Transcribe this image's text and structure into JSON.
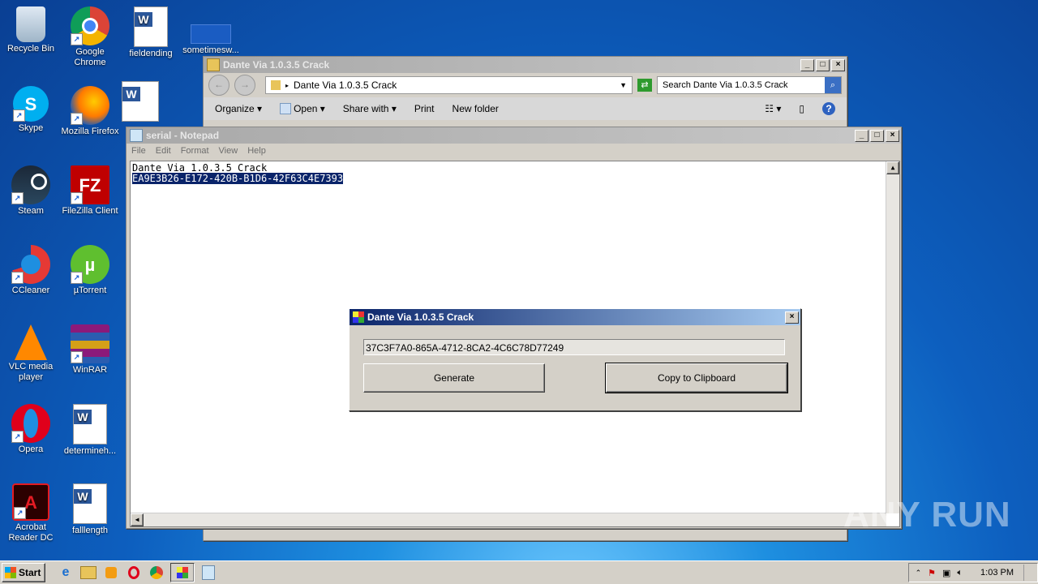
{
  "desktop": {
    "icons": [
      {
        "label": "Recycle Bin"
      },
      {
        "label": "Google Chrome"
      },
      {
        "label": "fieldending"
      },
      {
        "label": "sometimesw..."
      },
      {
        "label": "Skype"
      },
      {
        "label": "Mozilla Firefox"
      },
      {
        "label": "Steam"
      },
      {
        "label": "FileZilla Client"
      },
      {
        "label": "CCleaner"
      },
      {
        "label": "µTorrent"
      },
      {
        "label": "VLC media player"
      },
      {
        "label": "WinRAR"
      },
      {
        "label": "Opera"
      },
      {
        "label": "determineh..."
      },
      {
        "label": "Acrobat Reader DC"
      },
      {
        "label": "falllength"
      }
    ]
  },
  "explorer": {
    "title": "Dante Via 1.0.3.5 Crack",
    "address": "Dante Via 1.0.3.5 Crack",
    "search_placeholder": "Search Dante Via 1.0.3.5 Crack",
    "toolbar": {
      "organize": "Organize",
      "open": "Open",
      "share_with": "Share with",
      "print": "Print",
      "new_folder": "New folder"
    }
  },
  "notepad": {
    "title": "serial - Notepad",
    "menu": [
      "File",
      "Edit",
      "Format",
      "View",
      "Help"
    ],
    "line1": "Dante Via 1.0.3.5 Crack",
    "line2_selected": "EA9E3B26-E172-420B-B1D6-42F63C4E7393"
  },
  "keygen": {
    "title": "Dante Via 1.0.3.5 Crack",
    "serial_value": "37C3F7A0-865A-4712-8CA2-4C6C78D77249",
    "generate_label": "Generate",
    "copy_label": "Copy to Clipboard"
  },
  "taskbar": {
    "start_label": "Start",
    "clock": "1:03 PM"
  },
  "watermark": "ANY RUN",
  "colors": {
    "active_title_start": "#0a246a",
    "active_title_end": "#a6caf0",
    "selection": "#0a246a"
  }
}
